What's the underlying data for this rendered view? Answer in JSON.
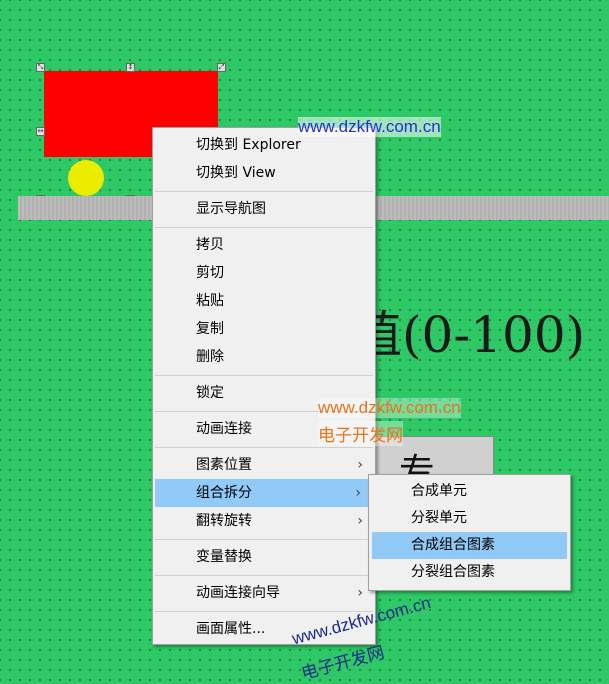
{
  "watermarks": {
    "top_url": "www.dzkfw.com.cn",
    "mid_url": "www.dzkfw.com.cn",
    "mid_cn": "电子开发网",
    "bottom_url": "www.dzkfw.com.cn",
    "bottom_cn": "电子开发网"
  },
  "canvas": {
    "big_label": "值(0-100)",
    "button_glyph": "专"
  },
  "context_menu": {
    "items": [
      {
        "label": "切换到 Explorer"
      },
      {
        "label": "切换到 View"
      },
      {
        "label": "显示导航图"
      },
      {
        "label": "拷贝"
      },
      {
        "label": "剪切"
      },
      {
        "label": "粘贴"
      },
      {
        "label": "复制"
      },
      {
        "label": "删除"
      },
      {
        "label": "锁定"
      },
      {
        "label": "动画连接"
      },
      {
        "label": "图素位置"
      },
      {
        "label": "组合拆分"
      },
      {
        "label": "翻转旋转"
      },
      {
        "label": "变量替换"
      },
      {
        "label": "动画连接向导"
      },
      {
        "label": "画面属性..."
      }
    ],
    "highlighted": "组合拆分"
  },
  "submenu": {
    "items": [
      {
        "label": "合成单元"
      },
      {
        "label": "分裂单元"
      },
      {
        "label": "合成组合图素"
      },
      {
        "label": "分裂组合图素"
      }
    ],
    "highlighted": "合成组合图素"
  },
  "icons": {
    "submenu_arrow": "chevron-right-icon",
    "resize_handle": "resize-handle-icon"
  },
  "colors": {
    "canvas_bg": "#2ec866",
    "red_rect": "#ff0000",
    "yellow_circle": "#ecec00",
    "menu_highlight": "#91c9f7"
  }
}
